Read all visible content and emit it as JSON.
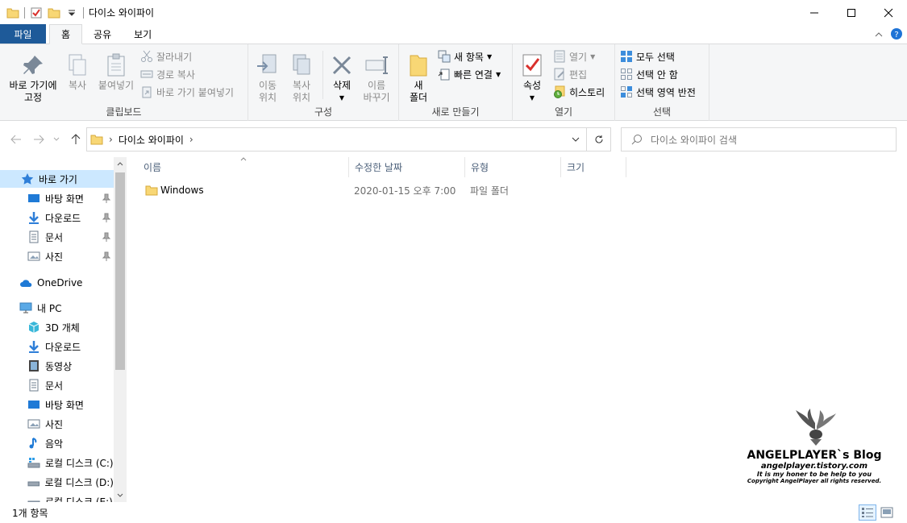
{
  "window": {
    "title": "다이소 와이파이"
  },
  "ribbon_tabs": {
    "file": "파일",
    "home": "홈",
    "share": "공유",
    "view": "보기"
  },
  "clipboard": {
    "pin_label_1": "바로 가기에",
    "pin_label_2": "고정",
    "copy": "복사",
    "paste": "붙여넣기",
    "cut": "잘라내기",
    "copy_path": "경로 복사",
    "paste_shortcut": "바로 가기 붙여넣기",
    "group": "클립보드"
  },
  "organize": {
    "move_1": "이동",
    "move_2": "위치",
    "copy_1": "복사",
    "copy_2": "위치",
    "delete": "삭제",
    "rename_1": "이름",
    "rename_2": "바꾸기",
    "group": "구성"
  },
  "new": {
    "folder_1": "새",
    "folder_2": "폴더",
    "new_item": "새 항목",
    "easy_access": "빠른 연결",
    "group": "새로 만들기"
  },
  "open": {
    "properties": "속성",
    "open": "열기",
    "edit": "편집",
    "history": "히스토리",
    "group": "열기"
  },
  "select": {
    "select_all": "모두 선택",
    "select_none": "선택 안 함",
    "invert": "선택 영역 반전",
    "group": "선택"
  },
  "address": {
    "path": "다이소 와이파이",
    "search_placeholder": "다이소 와이파이 검색"
  },
  "nav": {
    "quick_access": "바로 가기",
    "desktop": "바탕 화면",
    "downloads": "다운로드",
    "documents": "문서",
    "pictures": "사진",
    "onedrive": "OneDrive",
    "this_pc": "내 PC",
    "objects3d": "3D 개체",
    "downloads2": "다운로드",
    "videos": "동영상",
    "documents2": "문서",
    "desktop2": "바탕 화면",
    "pictures2": "사진",
    "music": "음악",
    "disk_c": "로컬 디스크 (C:)",
    "disk_d": "로컬 디스크 (D:)",
    "disk_e": "로컬 디스크 (E:)"
  },
  "columns": {
    "name": "이름",
    "modified": "수정한 날짜",
    "type": "유형",
    "size": "크기"
  },
  "files": [
    {
      "name": "Windows",
      "modified": "2020-01-15 오후 7:00",
      "type": "파일 폴더",
      "size": ""
    }
  ],
  "status": {
    "count": "1개 항목"
  },
  "watermark": {
    "title": "ANGELPLAYER`s Blog",
    "url": "angelplayer.tistory.com",
    "tagline": "It is my honer to be help to you",
    "copyright": "Copyright AngelPlayer all rights reserved."
  },
  "colors": {
    "file_tab": "#1e5a99",
    "selection": "#cce8ff",
    "folder": "#f8d775"
  }
}
